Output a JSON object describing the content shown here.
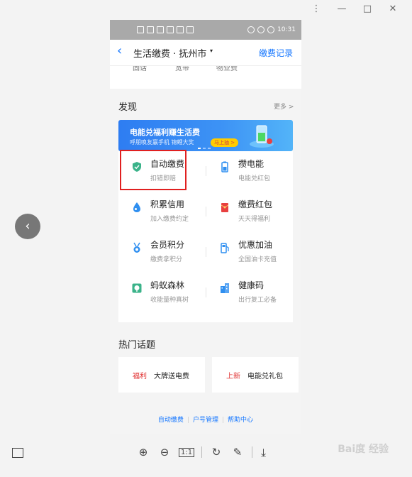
{
  "window": {
    "controls": [
      "⋮",
      "—",
      "□",
      "✕"
    ]
  },
  "statusbar": {
    "time": "10:31"
  },
  "nav": {
    "back_icon": "chevron-left-icon",
    "title": "生活缴费 · 抚州市",
    "caret": "▾",
    "record": "缴费记录"
  },
  "prev_strip": [
    "固话",
    "宽带",
    "物业费"
  ],
  "discover": {
    "title": "发现",
    "more": "更多 >"
  },
  "banner": {
    "title": "电能兑福利赚生活费",
    "subtitle": "呼朋唤友赢手机 锦鲤大奖",
    "button": "马上抽 >"
  },
  "grid": [
    {
      "name": "自动缴费",
      "desc": "扣错即赔",
      "icon": "shield-check-icon",
      "color": "#3bb38a"
    },
    {
      "name": "攒电能",
      "desc": "电能兑红包",
      "icon": "battery-icon",
      "color": "#2f8ff0"
    },
    {
      "name": "积累信用",
      "desc": "加入缴费约定",
      "icon": "water-drop-icon",
      "color": "#2f8ff0"
    },
    {
      "name": "缴费红包",
      "desc": "天天得福利",
      "icon": "red-envelope-icon",
      "color": "#e84040"
    },
    {
      "name": "会员积分",
      "desc": "缴费拿积分",
      "icon": "medal-icon",
      "color": "#2f8ff0"
    },
    {
      "name": "优惠加油",
      "desc": "全国油卡充值",
      "icon": "fuel-icon",
      "color": "#2f8ff0"
    },
    {
      "name": "蚂蚁森林",
      "desc": "收能量种真树",
      "icon": "tree-icon",
      "color": "#3bb38a"
    },
    {
      "name": "健康码",
      "desc": "出行复工必备",
      "icon": "building-icon",
      "color": "#2f8ff0"
    }
  ],
  "hot": {
    "title": "热门话题",
    "topics": [
      {
        "tag": "福利",
        "text": "大牌送电费"
      },
      {
        "tag": "上新",
        "text": "电能兑礼包"
      }
    ]
  },
  "footer": [
    "自动缴费",
    "户号管理",
    "帮助中心"
  ],
  "viewer": {
    "toolbar": [
      "⊕",
      "⊖",
      "1:1",
      "↻",
      "✎"
    ],
    "download": "⤓",
    "watermark": "Bai度 经验"
  }
}
